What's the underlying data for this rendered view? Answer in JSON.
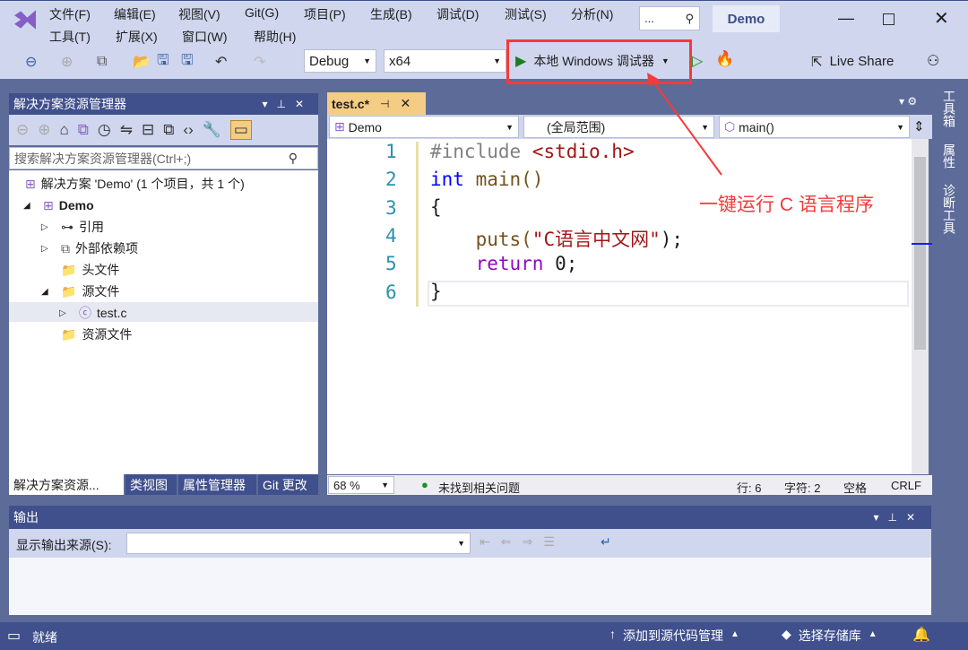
{
  "menu": {
    "row1": [
      "文件(F)",
      "编辑(E)",
      "视图(V)",
      "Git(G)",
      "项目(P)",
      "生成(B)",
      "调试(D)",
      "测试(S)",
      "分析(N)"
    ],
    "row2": [
      "工具(T)",
      "扩展(X)",
      "窗口(W)",
      "帮助(H)"
    ]
  },
  "search_box": "...",
  "window_title": "Demo",
  "toolbar": {
    "config": "Debug",
    "platform": "x64",
    "run_label": "本地 Windows 调试器",
    "live_share": "Live Share"
  },
  "solution_explorer": {
    "title": "解决方案资源管理器",
    "search_placeholder": "搜索解决方案资源管理器(Ctrl+;)",
    "tree": [
      "解决方案 'Demo' (1 个项目，共 1 个)",
      "Demo",
      "引用",
      "外部依赖项",
      "头文件",
      "源文件",
      "test.c",
      "资源文件"
    ],
    "tabs": [
      "解决方案资源...",
      "类视图",
      "属性管理器",
      "Git 更改"
    ]
  },
  "editor": {
    "tab": "test.c*",
    "nav": [
      "Demo",
      "(全局范围)",
      "main()"
    ],
    "lines": [
      "1",
      "2",
      "3",
      "4",
      "5",
      "6"
    ],
    "code": {
      "l1a": "#include ",
      "l1b": "<stdio.h>",
      "l2a": "int",
      "l2b": " main()",
      "l3": "{",
      "l4a": "    puts(",
      "l4b": "\"C语言中文网\"",
      "l4c": ");",
      "l5a": "    return",
      "l5b": " 0;",
      "l6": "}"
    },
    "zoom": "68 %",
    "issues": "未找到相关问题",
    "row": "行: 6",
    "col": "字符: 2",
    "spacing": "空格",
    "eol": "CRLF"
  },
  "right_tabs": [
    "工具箱",
    "属性",
    "诊断工具"
  ],
  "annotation": "一键运行 C 语言程序",
  "output": {
    "title": "输出",
    "source_label": "显示输出来源(S):"
  },
  "statusbar": {
    "ready": "就绪",
    "add_source": "添加到源代码管理",
    "select_repo": "选择存储库"
  }
}
